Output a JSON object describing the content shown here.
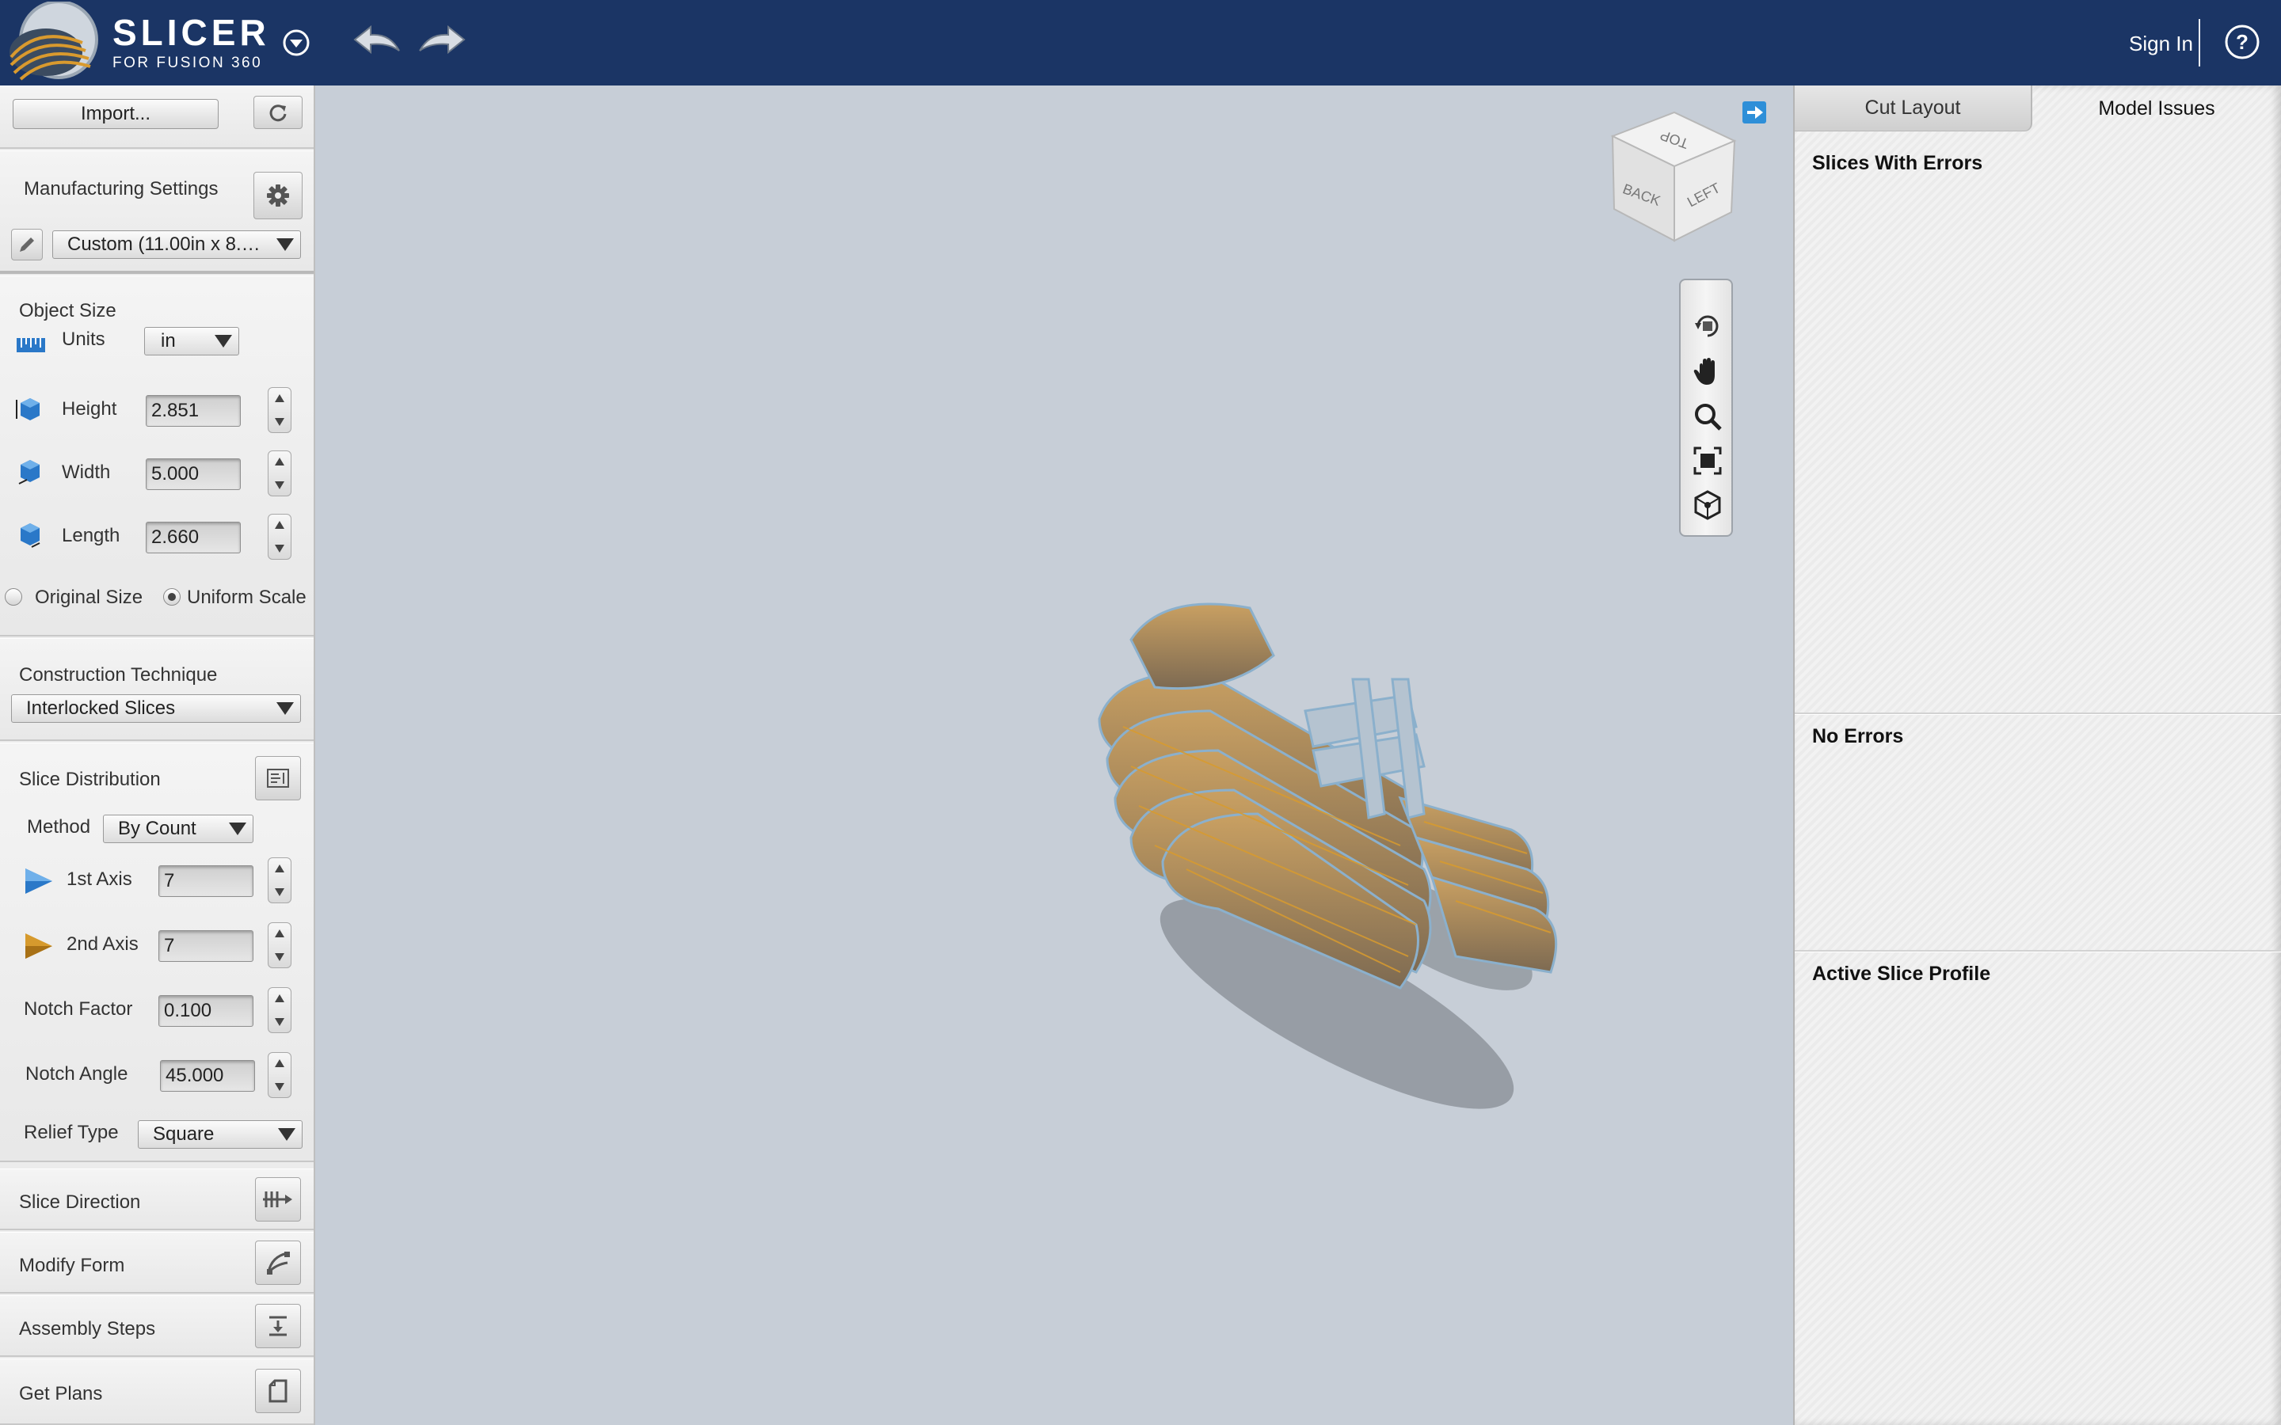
{
  "app": {
    "title": "SLICER",
    "subtitle": "FOR FUSION 360",
    "sign_in": "Sign In",
    "help": "?"
  },
  "left_panel": {
    "import_label": "Import...",
    "manufacturing": {
      "title": "Manufacturing Settings",
      "preset": "Custom (11.00in x 8.…"
    },
    "object_size": {
      "title": "Object Size",
      "units_label": "Units",
      "units_value": "in",
      "height_label": "Height",
      "height_value": "2.851",
      "width_label": "Width",
      "width_value": "5.000",
      "length_label": "Length",
      "length_value": "2.660",
      "original_size_label": "Original Size",
      "uniform_scale_label": "Uniform Scale",
      "original_size_checked": false,
      "uniform_scale_checked": true
    },
    "construction": {
      "title": "Construction Technique",
      "value": "Interlocked Slices"
    },
    "slice_distribution": {
      "title": "Slice Distribution",
      "method_label": "Method",
      "method_value": "By Count",
      "axis1_label": "1st Axis",
      "axis1_value": "7",
      "axis2_label": "2nd Axis",
      "axis2_value": "7",
      "notch_factor_label": "Notch Factor",
      "notch_factor_value": "0.100",
      "notch_angle_label": "Notch Angle",
      "notch_angle_value": "45.000",
      "relief_type_label": "Relief Type",
      "relief_type_value": "Square"
    },
    "sections": {
      "slice_direction": "Slice Direction",
      "modify_form": "Modify Form",
      "assembly_steps": "Assembly Steps",
      "get_plans": "Get Plans"
    }
  },
  "viewcube": {
    "top": "TOP",
    "back": "BACK",
    "left": "LEFT"
  },
  "right_panel": {
    "tabs": [
      "Cut Layout",
      "Model Issues"
    ],
    "active_tab": "Model Issues",
    "slices_with_errors": "Slices With Errors",
    "no_errors": "No Errors",
    "active_slice_profile": "Active Slice Profile"
  },
  "colors": {
    "topbar": "#1b3565",
    "accent": "#2e8fd8",
    "axis1": "#2a78c8",
    "axis2": "#d69a2d",
    "viewport": "#c7ced7"
  },
  "icons": [
    "menu-caret-icon",
    "undo-icon",
    "redo-icon",
    "help-icon",
    "refresh-icon",
    "gear-icon",
    "pencil-icon",
    "ruler-icon",
    "height-icon",
    "width-icon",
    "length-icon",
    "list-icon",
    "slice-direction-icon",
    "modify-form-icon",
    "assembly-icon",
    "plans-icon",
    "orbit-icon",
    "pan-icon",
    "zoom-icon",
    "fit-icon",
    "home-view-icon",
    "expand-icon"
  ]
}
